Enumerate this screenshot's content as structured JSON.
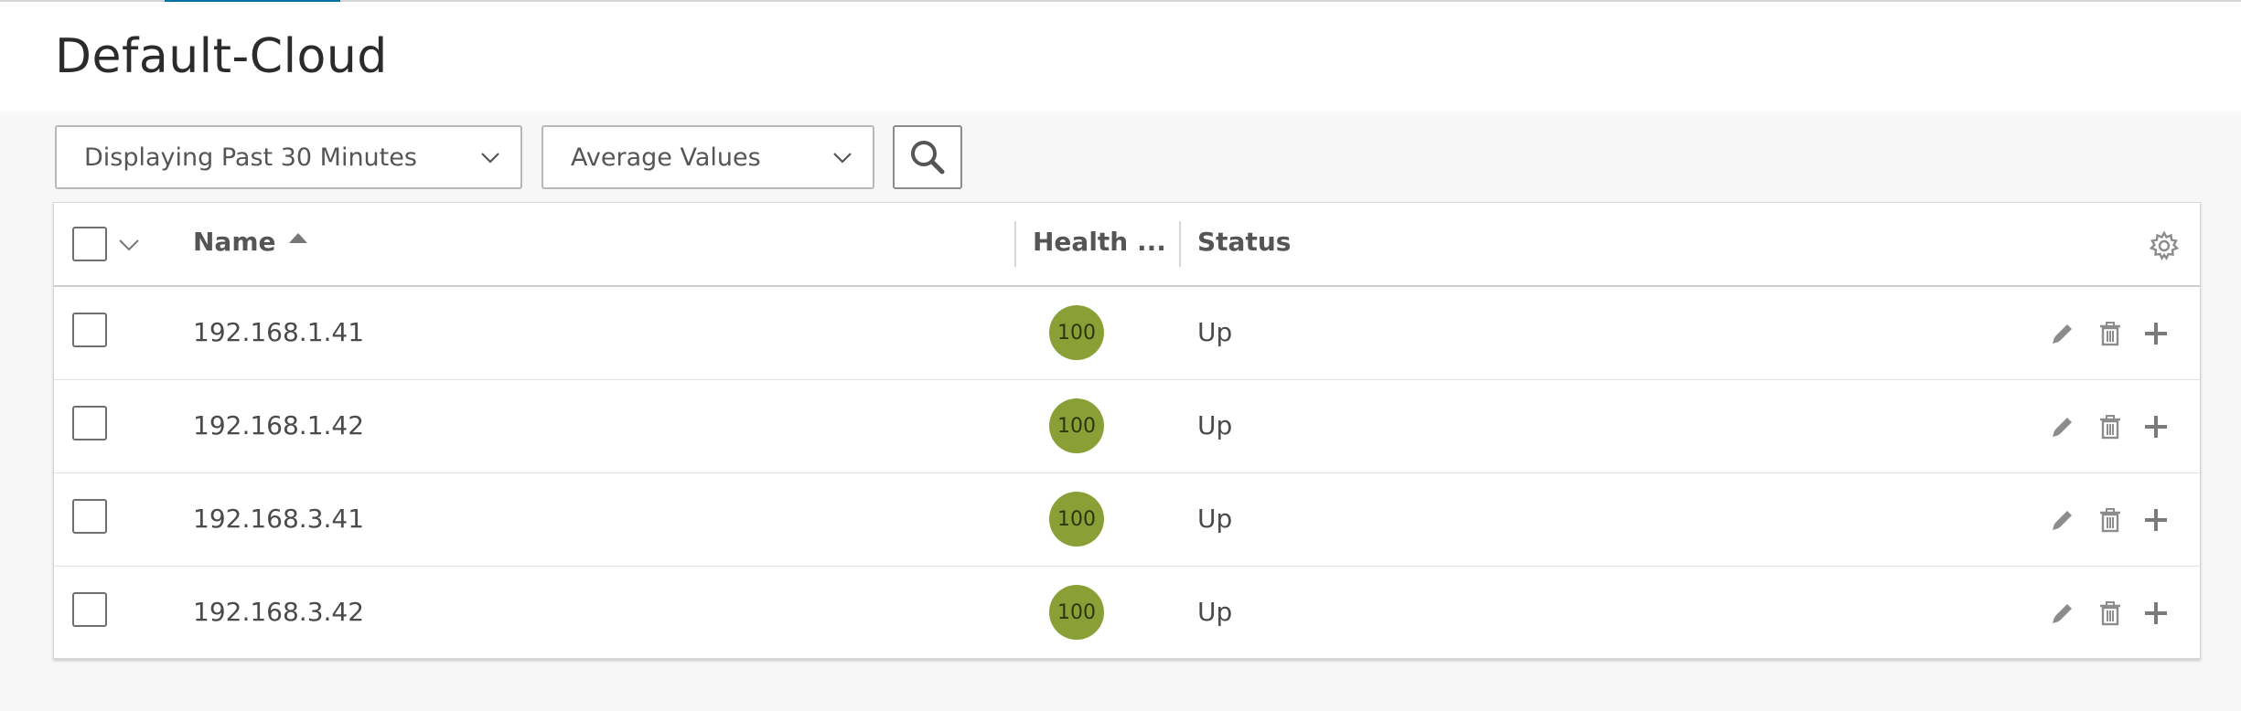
{
  "page": {
    "title": "Default-Cloud"
  },
  "toolbar": {
    "time_range": "Displaying Past 30 Minutes",
    "value_mode": "Average Values"
  },
  "grid": {
    "columns": {
      "name": "Name",
      "health": "Health ...",
      "status": "Status"
    },
    "rows": [
      {
        "name": "192.168.1.41",
        "health": "100",
        "status": "Up"
      },
      {
        "name": "192.168.1.42",
        "health": "100",
        "status": "Up"
      },
      {
        "name": "192.168.3.41",
        "health": "100",
        "status": "Up"
      },
      {
        "name": "192.168.3.42",
        "health": "100",
        "status": "Up"
      }
    ]
  },
  "colors": {
    "accent": "#0072a3",
    "health_good": "#8a9f36",
    "icon_gray": "#8c8c8c"
  },
  "icons": {
    "sort": "caret-up-icon",
    "search": "search-icon",
    "settings": "gear-icon",
    "edit": "pencil-icon",
    "delete": "trash-icon",
    "add": "plus-icon"
  }
}
